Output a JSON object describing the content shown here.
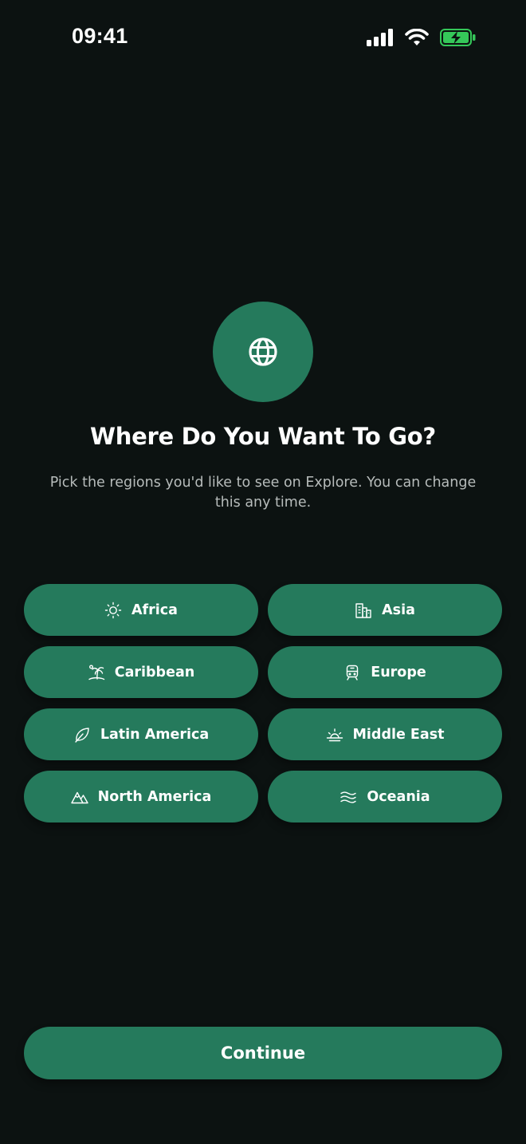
{
  "status_bar": {
    "time": "09:41",
    "battery_color": "#35c759"
  },
  "header": {
    "icon": "globe-icon",
    "title": "Where Do You Want To Go?",
    "subtitle": "Pick the regions you'd like to see on Explore. You can change this any time."
  },
  "regions": [
    {
      "label": "Africa",
      "icon": "sun-icon"
    },
    {
      "label": "Asia",
      "icon": "buildings-icon"
    },
    {
      "label": "Caribbean",
      "icon": "palm-tree-icon"
    },
    {
      "label": "Europe",
      "icon": "train-icon"
    },
    {
      "label": "Latin America",
      "icon": "leaf-icon"
    },
    {
      "label": "Middle East",
      "icon": "sunrise-icon"
    },
    {
      "label": "North America",
      "icon": "mountains-icon"
    },
    {
      "label": "Oceania",
      "icon": "waves-icon"
    }
  ],
  "footer": {
    "continue_label": "Continue"
  },
  "colors": {
    "background": "#0c1211",
    "accent": "#257a5c",
    "subtitle_text": "#b7bcbb"
  }
}
